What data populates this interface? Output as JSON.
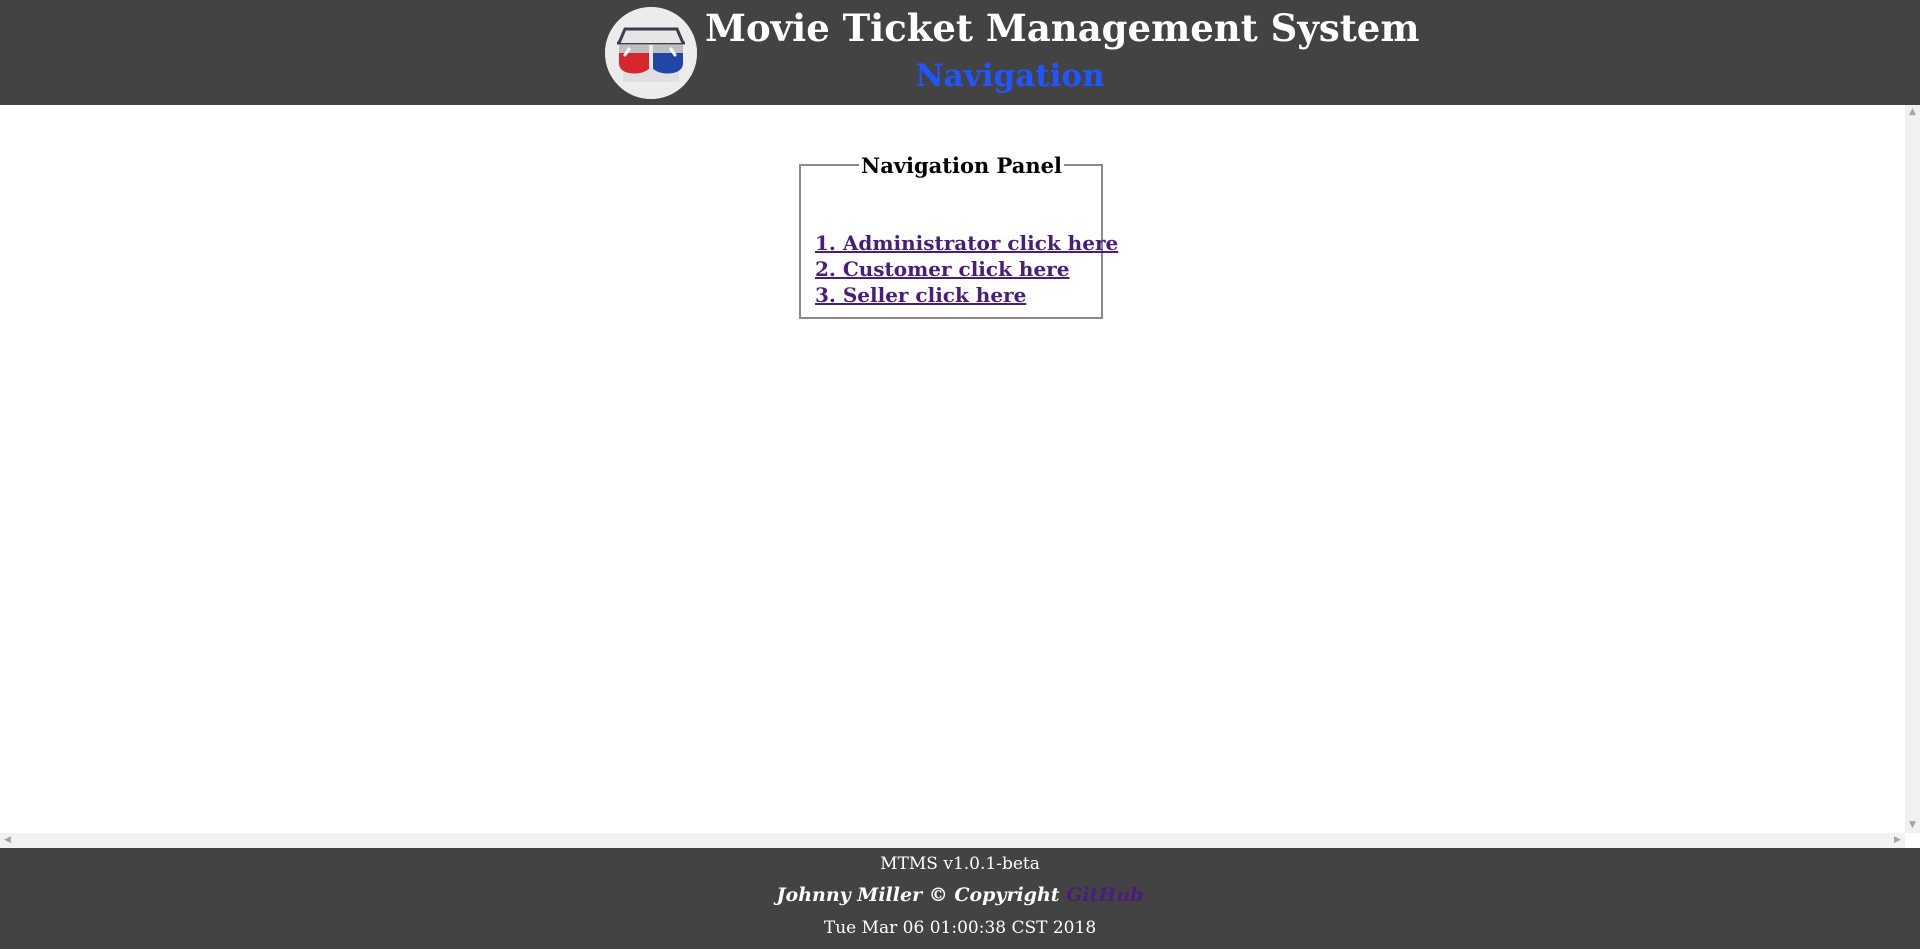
{
  "header": {
    "title": "Movie Ticket Management System",
    "subtitle": "Navigation",
    "logo_icon": "3d-glasses-icon"
  },
  "nav_panel": {
    "legend": "Navigation Panel",
    "links": [
      {
        "label": "1. Administrator click here"
      },
      {
        "label": "2. Customer click here"
      },
      {
        "label": "3. Seller click here"
      }
    ]
  },
  "footer": {
    "version": "MTMS v1.0.1-beta",
    "credit": "Johnny Miller © Copyright",
    "github_label": "GitHub",
    "timestamp": "Tue Mar 06 01:00:38 CST 2018"
  },
  "colors": {
    "header_bg": "#434343",
    "subtitle": "#2155ff",
    "link": "#4a1c7c"
  }
}
